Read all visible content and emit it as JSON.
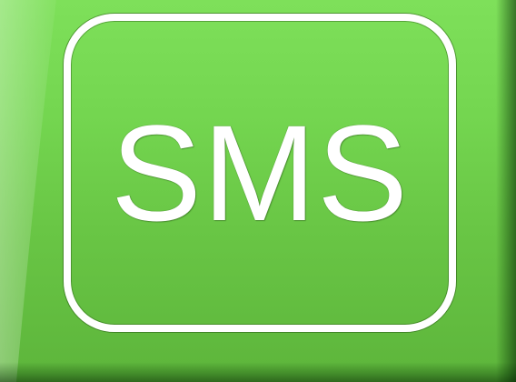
{
  "icon": {
    "text": "SMS",
    "name": "sms-message-icon",
    "colors": {
      "tile_top": "#7ee05a",
      "tile_bottom": "#5db53b",
      "foreground": "#ffffff"
    }
  }
}
